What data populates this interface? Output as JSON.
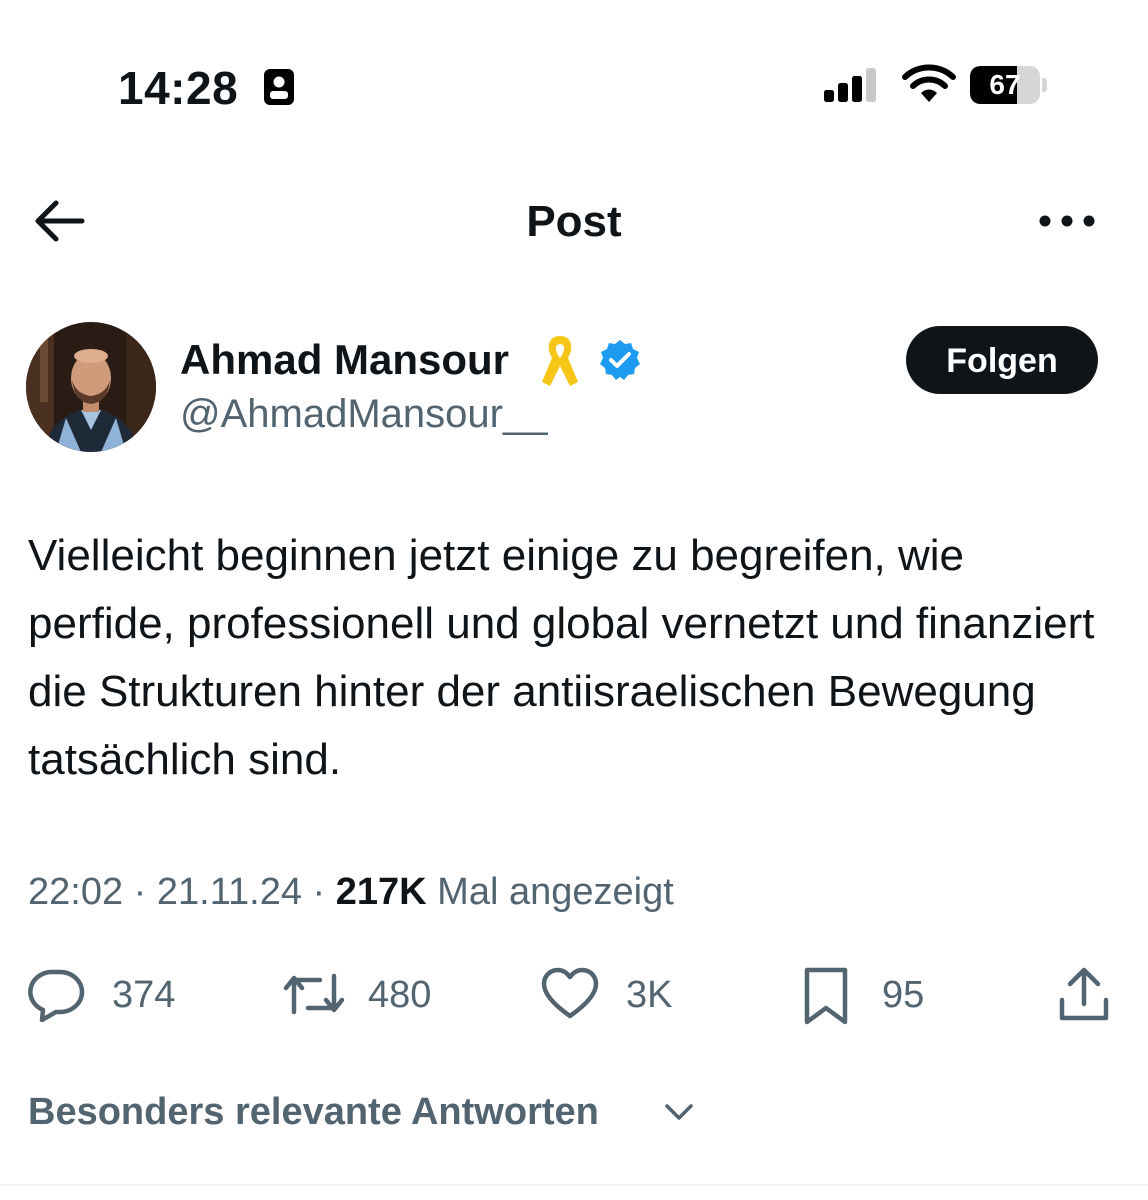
{
  "status_bar": {
    "time": "14:28",
    "battery_percent": 67,
    "battery_label": "67",
    "focus_icon": "person-id-icon",
    "signal_icon": "cellular-signal-icon",
    "wifi_icon": "wifi-icon"
  },
  "header": {
    "title": "Post",
    "back_icon": "arrow-left-icon",
    "more_icon": "ellipsis-icon"
  },
  "author": {
    "name": "Ahmad Mansour",
    "handle": "@AhmadMansour__",
    "badge_icon": "yellow-ribbon-icon",
    "verified_icon": "verified-badge-icon",
    "follow_label": "Folgen"
  },
  "post": {
    "text": "Vielleicht beginnen jetzt einige zu begreifen, wie perfide, professionell und global vernetzt und finanziert die Strukturen hinter der antiisraelischen Bewegung tatsächlich sind.",
    "time": "22:02",
    "date": "21.11.24",
    "views": "217K",
    "views_label": "Mal angezeigt",
    "separator": "·"
  },
  "actions": {
    "replies": "374",
    "reposts": "480",
    "likes": "3K",
    "bookmarks": "95"
  },
  "replies_sort": {
    "label": "Besonders relevante Antworten"
  },
  "colors": {
    "text_primary": "#0f1419",
    "text_secondary": "#536471",
    "verified_blue": "#1d9bf0",
    "ribbon_yellow": "#f5c518",
    "follow_bg": "#0f1419"
  }
}
